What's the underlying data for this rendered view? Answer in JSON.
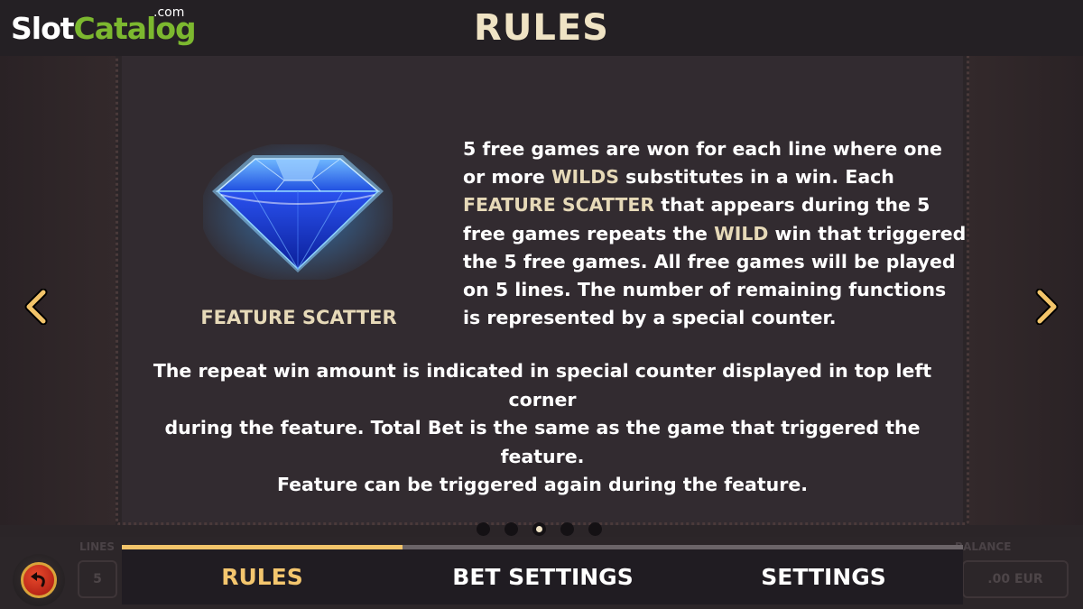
{
  "brand": {
    "slot": "Slot",
    "catalog": "Catalog",
    "com": ".com"
  },
  "header": {
    "title": "RULES"
  },
  "feature": {
    "symbol_label": "FEATURE SCATTER",
    "symbol_icon": "blue-diamond-icon",
    "description": {
      "p1": "5 free games are won for each line where one or more ",
      "h1": "WILDS",
      "p2": " substitutes in a win. Each ",
      "h2": "FEATURE SCATTER",
      "p3": " that appears during the 5 free games repeats the ",
      "h3": "WILD",
      "p4": " win that triggered the 5 free games. All free games will be played on 5 lines. The number of remaining functions is represented by a special counter."
    },
    "note_lines": [
      "The repeat win amount is indicated in special counter displayed in top left corner",
      "during the feature. Total Bet is the same as the game that triggered the feature.",
      "Feature can be triggered again during the feature."
    ]
  },
  "pagination": {
    "total": 5,
    "active_index": 2
  },
  "tabs": [
    {
      "label": "RULES",
      "active": true
    },
    {
      "label": "BET SETTINGS",
      "active": false
    },
    {
      "label": "SETTINGS",
      "active": false
    }
  ],
  "background_hud": {
    "lines_label": "LINES",
    "lines_value": "5",
    "balance_label": "BALANCE",
    "balance_value": ".00 EUR"
  },
  "colors": {
    "accent": "#f4c66e",
    "highlight_text": "#e6d9b8",
    "panel": "#322b30",
    "brand_green": "#7cb82f"
  }
}
